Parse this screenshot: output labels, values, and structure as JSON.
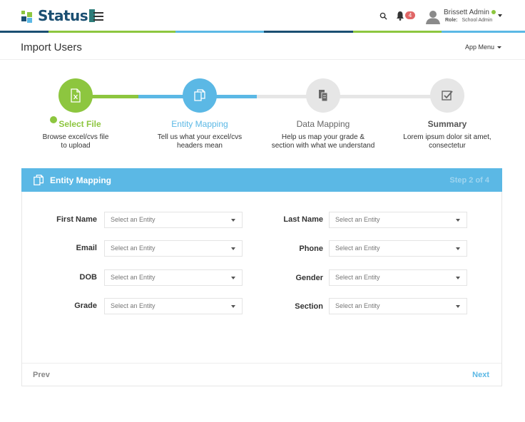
{
  "header": {
    "logo_text": "Status",
    "notification_count": "4",
    "user_name": "Brissett Admin",
    "role_label": "Role:",
    "role_value": "School Admin",
    "icons": [
      "menu-icon",
      "search-icon",
      "bell-icon",
      "avatar",
      "chevron-down-icon"
    ]
  },
  "subheader": {
    "page_title": "Import Users",
    "app_menu": "App Menu"
  },
  "wizard": {
    "current_step": 2,
    "steps": [
      {
        "title": "Select File",
        "desc_line1": "Browse excel/cvs file",
        "desc_line2": "to upload",
        "icon": "excel-file-icon",
        "state": "completed"
      },
      {
        "title": "Entity Mapping",
        "desc_line1": "Tell us what your excel/cvs",
        "desc_line2": "headers mean",
        "icon": "copy-icon",
        "state": "active"
      },
      {
        "title": "Data Mapping",
        "desc_line1": "Help us map your grade &",
        "desc_line2": "section with what we understand",
        "icon": "documents-icon",
        "state": "pending"
      },
      {
        "title": "Summary",
        "desc_line1": "Lorem ipsum dolor sit amet,",
        "desc_line2": "consectetur",
        "icon": "checklist-icon",
        "state": "pending"
      }
    ]
  },
  "panel": {
    "title": "Entity Mapping",
    "step_text": "Step 2 of 4",
    "placeholder": "Select an Entity",
    "fields_left": [
      "First Name",
      "Email",
      "DOB",
      "Grade"
    ],
    "fields_right": [
      "Last Name",
      "Phone",
      "Gender",
      "Section"
    ],
    "prev_label": "Prev",
    "next_label": "Next"
  },
  "colors": {
    "green": "#8dc63f",
    "blue": "#5bb8e5",
    "navy": "#1b4f72",
    "grey_circle": "#e6e6e6"
  }
}
